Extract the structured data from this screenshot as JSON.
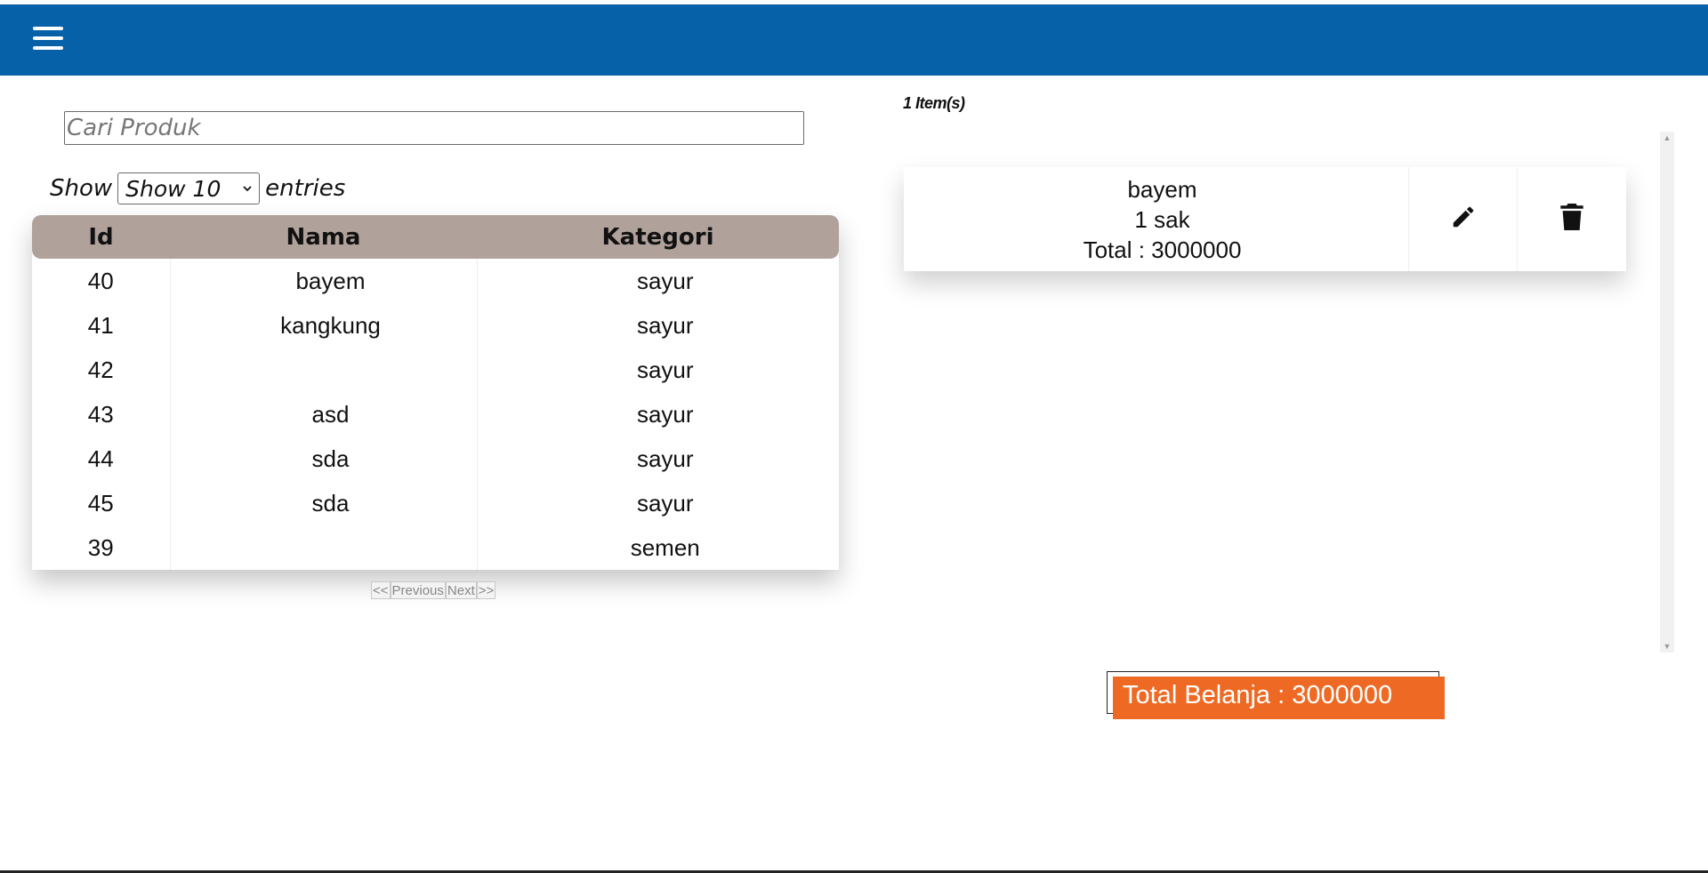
{
  "header": {
    "bg_color": "#0761a8",
    "menu_icon": "hamburger-icon"
  },
  "search": {
    "placeholder": "Cari Produk",
    "value": ""
  },
  "entries": {
    "show_label": "Show",
    "select_value": "Show 10",
    "entries_label": "entries"
  },
  "table": {
    "header_color": "#b0a19b",
    "columns": [
      "Id",
      "Nama",
      "Kategori"
    ],
    "rows": [
      {
        "id": "40",
        "nama": "bayem",
        "kategori": "sayur"
      },
      {
        "id": "41",
        "nama": "kangkung",
        "kategori": "sayur"
      },
      {
        "id": "42",
        "nama": "",
        "kategori": "sayur"
      },
      {
        "id": "43",
        "nama": "asd",
        "kategori": "sayur"
      },
      {
        "id": "44",
        "nama": "sda",
        "kategori": "sayur"
      },
      {
        "id": "45",
        "nama": "sda",
        "kategori": "sayur"
      },
      {
        "id": "39",
        "nama": "",
        "kategori": "semen"
      }
    ]
  },
  "pagination": {
    "first": "<<",
    "previous": "Previous",
    "next": "Next",
    "last": ">>"
  },
  "cart": {
    "item_count": "1 Item(s)",
    "items": [
      {
        "name": "bayem",
        "qty": "1 sak",
        "total": "Total : 3000000",
        "edit_icon": "pencil-icon",
        "delete_icon": "trash-icon"
      }
    ],
    "grand_total": "Total Belanja : 3000000",
    "total_color": "#ee6a24"
  }
}
